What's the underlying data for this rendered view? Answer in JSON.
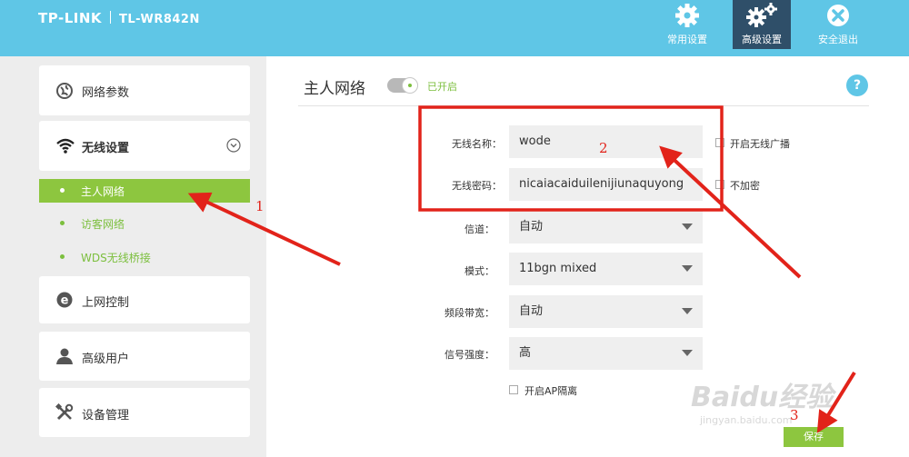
{
  "header": {
    "brand": "TP-LINK",
    "model": "TL-WR842N",
    "nav": [
      {
        "label": "常用设置",
        "icon": "gear-icon",
        "active": false
      },
      {
        "label": "高级设置",
        "icon": "gears-icon",
        "active": true
      },
      {
        "label": "安全退出",
        "icon": "logout-icon",
        "active": false
      }
    ]
  },
  "sidebar": {
    "network_params": "网络参数",
    "wireless": "无线设置",
    "wireless_sub": [
      "主人网络",
      "访客网络",
      "WDS无线桥接"
    ],
    "access_control": "上网控制",
    "advanced_users": "高级用户",
    "device_mgmt": "设备管理"
  },
  "main": {
    "title": "主人网络",
    "toggle_status": "已开启",
    "help": "?",
    "fields": {
      "ssid_label": "无线名称：",
      "ssid_value": "wode",
      "password_label": "无线密码：",
      "password_value": "nicaiacaiduilenijiunaquyong",
      "channel_label": "信道：",
      "channel_value": "自动",
      "mode_label": "模式：",
      "mode_value": "11bgn mixed",
      "bandwidth_label": "频段带宽：",
      "bandwidth_value": "自动",
      "signal_label": "信号强度：",
      "signal_value": "高"
    },
    "checkboxes": {
      "broadcast": "开启无线广播",
      "no_encrypt": "不加密",
      "ap_isolation": "开启AP隔离"
    },
    "save": "保存"
  },
  "annotations": [
    "1",
    "2",
    "3"
  ],
  "watermark": {
    "text": "Baidu经验",
    "sub": "jingyan.baidu.com"
  },
  "colors": {
    "header": "#5fc6e6",
    "accent_green": "#8dc63f",
    "active_nav": "#2f4f69",
    "annotation_red": "#e2231a"
  }
}
